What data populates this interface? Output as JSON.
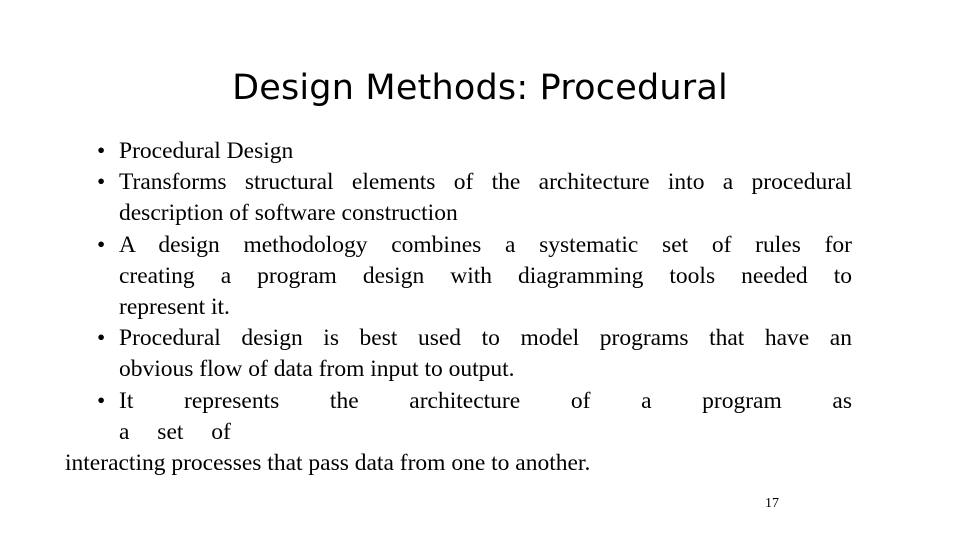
{
  "slide": {
    "title": "Design Methods: Procedural",
    "page_number": "17",
    "text_color": "#000000",
    "background_color": "#ffffff",
    "bullet_glyph": "•"
  },
  "bullets": [
    {
      "id": "procedural-design",
      "lines": [
        "Procedural Design"
      ],
      "full_text": "Procedural Design"
    },
    {
      "id": "transforms-structural-elements",
      "lines": [
        "Transforms structural elements of the architecture into  a procedural",
        "description of software construction"
      ],
      "full_text": "Transforms structural elements of the architecture into  a procedural description of software construction"
    },
    {
      "id": "design-methodology",
      "lines": [
        "A design methodology combines a systematic set of  rules for",
        "creating a program design with diagramming  tools needed to",
        "represent it."
      ],
      "full_text": "A design methodology combines a systematic set of  rules for creating a program design with diagramming  tools needed to represent it."
    },
    {
      "id": "best-used-to-model",
      "lines": [
        "Procedural design is best used to model programs that  have an",
        "obvious flow of data from input to output."
      ],
      "full_text": "Procedural design is best used to model programs that  have an obvious flow of data from input to output."
    },
    {
      "id": "represents-architecture",
      "lines": [
        "It represents the architecture of a program as",
        "a    set    of"
      ],
      "full_text": "It represents the architecture of a program as a set of"
    }
  ],
  "trailing_line": "interacting processes that pass data from one to another."
}
